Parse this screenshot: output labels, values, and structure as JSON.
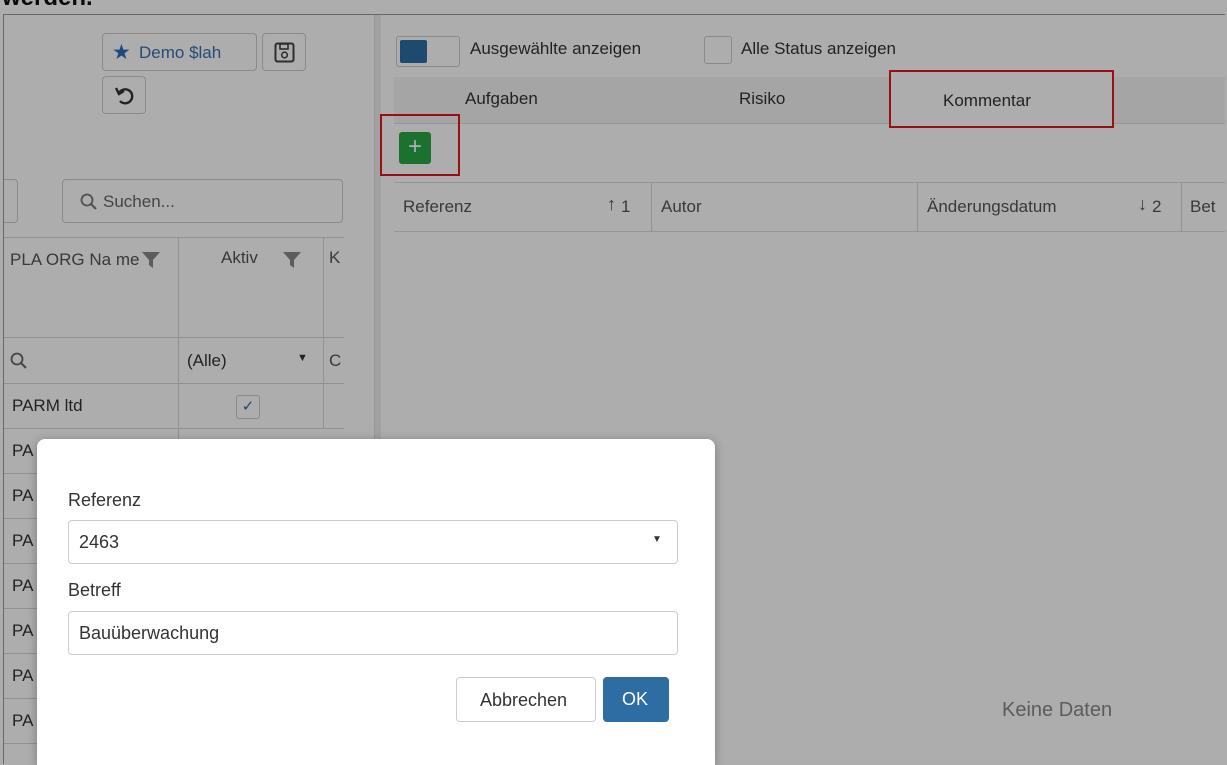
{
  "top_partial_text": "werden.",
  "left_panel": {
    "layout_button_label": "Demo $lah",
    "search_placeholder": "Suchen...",
    "columns": [
      "PLA ORG Na me",
      "Aktiv",
      "K"
    ],
    "filter_select_value": "(Alle)",
    "filter_partial": "C",
    "first_row_name": "PARM ltd",
    "row_prefix": "PA"
  },
  "toolbar": {
    "show_selected_label": "Ausgewählte anzeigen",
    "show_all_status_label": "Alle Status anzeigen"
  },
  "tabs": [
    "Aufgaben",
    "Risiko",
    "Kommentar"
  ],
  "grid": {
    "columns": [
      {
        "label": "Referenz",
        "sort": "1"
      },
      {
        "label": "Autor"
      },
      {
        "label": "Änderungsdatum",
        "sort": "2"
      },
      {
        "label": "Bet"
      }
    ],
    "empty_text": "Keine Daten"
  },
  "dialog": {
    "reference_label": "Referenz",
    "reference_value": "2463",
    "subject_label": "Betreff",
    "subject_value": "Bauüberwachung",
    "cancel_label": "Abbrechen",
    "ok_label": "OK"
  },
  "colors": {
    "accent_blue": "#2e6da4",
    "add_green": "#28a745",
    "highlight_red": "#e0191e",
    "star_blue": "#2a6ebb"
  }
}
